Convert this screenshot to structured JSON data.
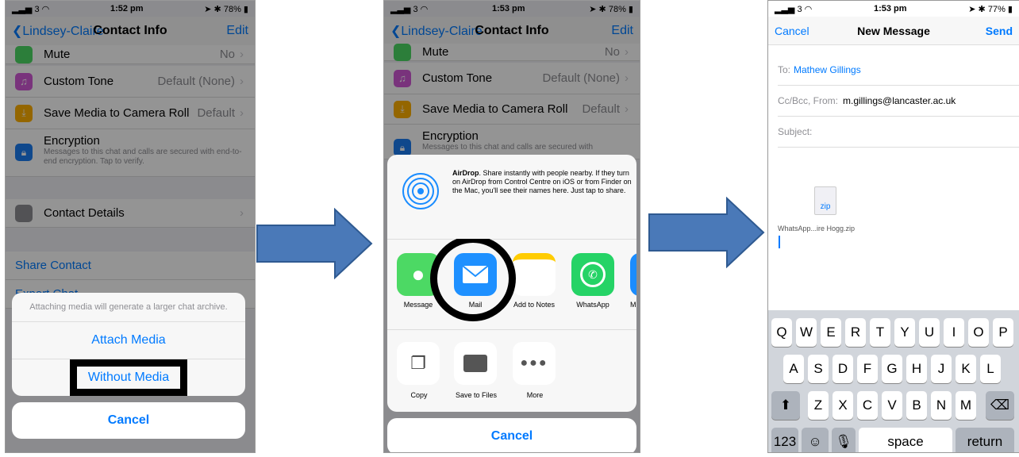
{
  "p1": {
    "status": {
      "carrier": "3",
      "time": "1:52 pm",
      "battery": "78%"
    },
    "nav": {
      "back": "Lindsey-Claire",
      "title": "Contact Info",
      "edit": "Edit"
    },
    "rows": [
      {
        "label": "Mute",
        "value": "No"
      },
      {
        "label": "Custom Tone",
        "value": "Default (None)"
      },
      {
        "label": "Save Media to Camera Roll",
        "value": "Default"
      },
      {
        "label": "Encryption",
        "sub": "Messages to this chat and calls are secured with end-to-end encryption. Tap to verify."
      },
      {
        "label": "Contact Details"
      }
    ],
    "share_contact": "Share Contact",
    "export_chat": "Export Chat",
    "sheet": {
      "message": "Attaching media will generate a larger chat archive.",
      "attach": "Attach Media",
      "without": "Without Media",
      "cancel": "Cancel"
    }
  },
  "p2": {
    "status": {
      "carrier": "3",
      "time": "1:53 pm",
      "battery": "78%"
    },
    "nav": {
      "back": "Lindsey-Claire",
      "title": "Contact Info",
      "edit": "Edit"
    },
    "rows": [
      {
        "label": "Mute",
        "value": "No"
      },
      {
        "label": "Custom Tone",
        "value": "Default (None)"
      },
      {
        "label": "Save Media to Camera Roll",
        "value": "Default"
      },
      {
        "label": "Encryption",
        "sub": "Messages to this chat and calls are secured with"
      }
    ],
    "airdrop": {
      "title": "AirDrop",
      "text": ". Share instantly with people nearby. If they turn on AirDrop from Control Centre on iOS or from Finder on the Mac, you'll see their names here. Just tap to share."
    },
    "apps": [
      "Message",
      "Mail",
      "Add to Notes",
      "WhatsApp",
      "M"
    ],
    "actions": [
      "Copy",
      "Save to Files",
      "More"
    ],
    "cancel": "Cancel"
  },
  "p3": {
    "status": {
      "carrier": "3",
      "time": "1:53 pm",
      "battery": "77%"
    },
    "nav": {
      "cancel": "Cancel",
      "title": "New Message",
      "send": "Send"
    },
    "to_label": "To:",
    "to_value": "Mathew Gillings",
    "cc_label": "Cc/Bcc, From:",
    "cc_value": "m.gillings@lancaster.ac.uk",
    "subject_label": "Subject:",
    "attachment": {
      "ext": "zip",
      "name": "WhatsApp...ire Hogg.zip"
    },
    "keyboard": {
      "row1": [
        "Q",
        "W",
        "E",
        "R",
        "T",
        "Y",
        "U",
        "I",
        "O",
        "P"
      ],
      "row2": [
        "A",
        "S",
        "D",
        "F",
        "G",
        "H",
        "J",
        "K",
        "L"
      ],
      "row3": [
        "Z",
        "X",
        "C",
        "V",
        "B",
        "N",
        "M"
      ],
      "numbers": "123",
      "space": "space",
      "return": "return"
    }
  },
  "colors": {
    "ios_blue": "#007aff",
    "arrow": "#4a79b8",
    "arrow_edge": "#2f5a91",
    "whatsapp": "#25d366",
    "highlight": "#000000"
  }
}
